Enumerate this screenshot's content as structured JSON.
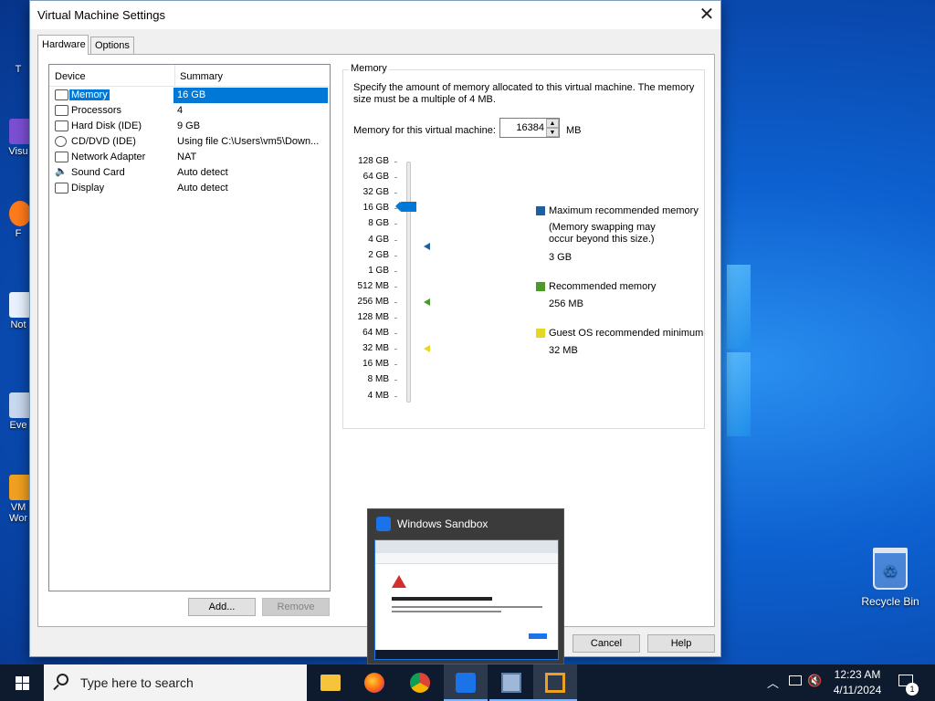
{
  "window": {
    "title": "Virtual Machine Settings"
  },
  "tabs": [
    {
      "label": "Hardware"
    },
    {
      "label": "Options"
    }
  ],
  "devices": {
    "header": {
      "device": "Device",
      "summary": "Summary"
    },
    "rows": [
      {
        "name": "Memory",
        "summary": "16 GB",
        "icon": "memory-icon"
      },
      {
        "name": "Processors",
        "summary": "4",
        "icon": "processor-icon"
      },
      {
        "name": "Hard Disk (IDE)",
        "summary": "9 GB",
        "icon": "hard-disk-icon"
      },
      {
        "name": "CD/DVD (IDE)",
        "summary": "Using file C:\\Users\\vm5\\Down...",
        "icon": "cd-dvd-icon"
      },
      {
        "name": "Network Adapter",
        "summary": "NAT",
        "icon": "network-adapter-icon"
      },
      {
        "name": "Sound Card",
        "summary": "Auto detect",
        "icon": "speaker-icon"
      },
      {
        "name": "Display",
        "summary": "Auto detect",
        "icon": "monitor-icon"
      }
    ],
    "add_label": "Add...",
    "remove_label": "Remove"
  },
  "memory": {
    "group_label": "Memory",
    "description": "Specify the amount of memory allocated to this virtual machine. The memory size must be a multiple of 4 MB.",
    "field_label": "Memory for this virtual machine:",
    "value": "16384",
    "unit": "MB",
    "scale": [
      "128 GB",
      "64 GB",
      "32 GB",
      "16 GB",
      "8 GB",
      "4 GB",
      "2 GB",
      "1 GB",
      "512 MB",
      "256 MB",
      "128 MB",
      "64 MB",
      "32 MB",
      "16 MB",
      "8 MB",
      "4 MB"
    ],
    "max_recommended": {
      "label": "Maximum recommended memory",
      "note": "(Memory swapping may occur beyond this size.)",
      "value": "3 GB",
      "color": "#1f5fa0"
    },
    "recommended": {
      "label": "Recommended memory",
      "value": "256 MB",
      "color": "#4a9a2a"
    },
    "guest_min": {
      "label": "Guest OS recommended minimum",
      "value": "32 MB",
      "color": "#e6d820"
    }
  },
  "footer": {
    "cancel_label": "Cancel",
    "help_label": "Help"
  },
  "preview": {
    "title": "Windows Sandbox"
  },
  "taskbar": {
    "search_placeholder": "Type here to search",
    "time": "12:23 AM",
    "date": "4/11/2024",
    "notification_count": "1",
    "apps": [
      "file-explorer",
      "firefox",
      "chrome",
      "windows-sandbox",
      "vmware-tool",
      "vmware-workstation"
    ]
  },
  "desktop": {
    "recycle_bin_label": "Recycle Bin"
  }
}
